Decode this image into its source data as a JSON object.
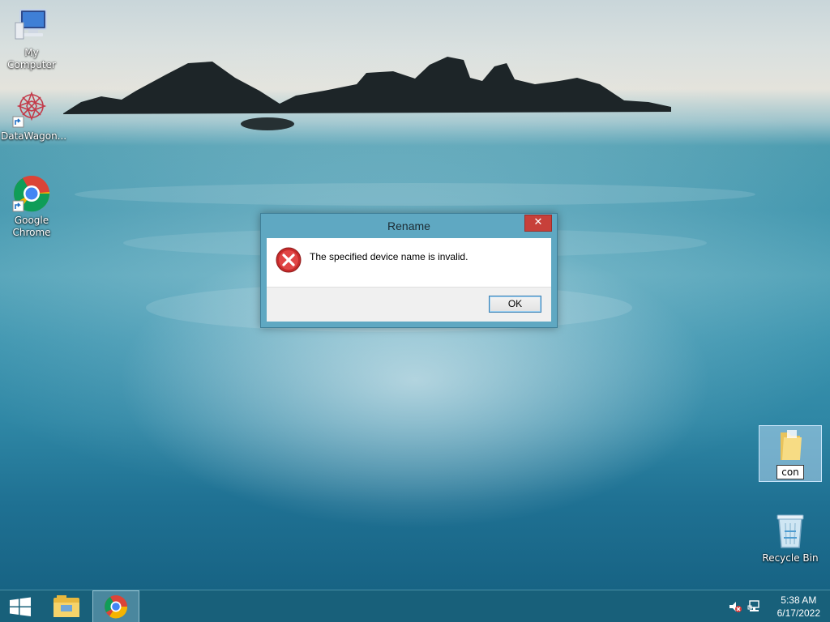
{
  "desktop": {
    "icons": [
      {
        "label": "My Computer",
        "icon": "computer-icon"
      },
      {
        "label": "DataWagon...",
        "icon": "datawagon-icon"
      },
      {
        "label": "Google Chrome",
        "label_line1": "Google",
        "label_line2": "Chrome",
        "icon": "chrome-icon"
      },
      {
        "label": "con",
        "icon": "folder-icon",
        "state": "renaming"
      },
      {
        "label": "Recycle Bin",
        "icon": "recycle-bin-icon"
      }
    ]
  },
  "dialog": {
    "title": "Rename",
    "close_label": "✕",
    "message": "The specified device name is invalid.",
    "ok_label": "OK",
    "icon": "error-icon"
  },
  "taskbar": {
    "start_icon": "windows-start-icon",
    "pinned": [
      {
        "name": "File Explorer",
        "icon": "file-explorer-icon"
      },
      {
        "name": "Google Chrome",
        "icon": "chrome-icon",
        "active": true
      }
    ],
    "tray": [
      {
        "icon": "volume-muted-icon"
      },
      {
        "icon": "network-icon"
      }
    ],
    "clock": {
      "time": "5:38 AM",
      "date": "6/17/2022"
    }
  },
  "colors": {
    "accent": "#5fa8c2",
    "close_red": "#c7403a",
    "taskbar": "#195f78"
  }
}
